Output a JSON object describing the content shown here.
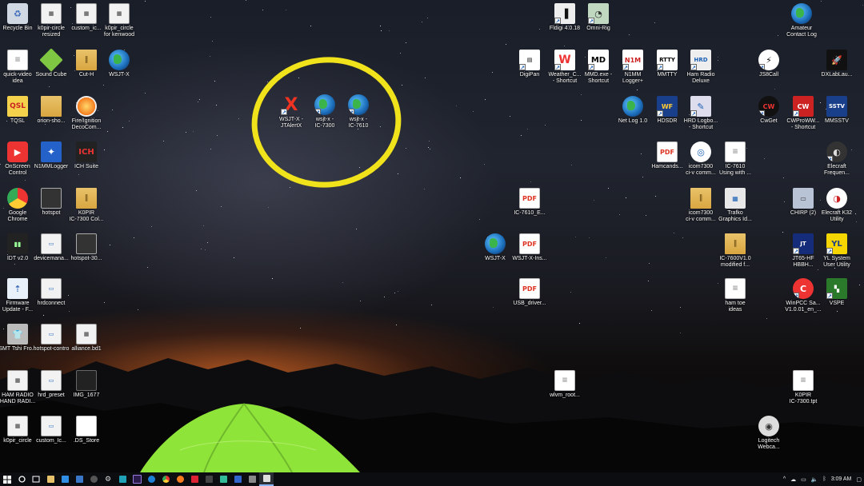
{
  "desktop": {
    "icons_left": [
      {
        "label": "Recycle Bin",
        "icon": "recycle-bin-icon"
      },
      {
        "label": "k0pir-circle\nresized",
        "icon": "image-icon"
      },
      {
        "label": "custom_ic...",
        "icon": "image-icon"
      },
      {
        "label": "k0pir_circle\nfor kenwood",
        "icon": "image-icon"
      },
      {
        "label": "quick-video\nidea",
        "icon": "document-icon"
      },
      {
        "label": "Sound Cube",
        "icon": "cube-icon"
      },
      {
        "label": "Cut-H",
        "icon": "archive-icon"
      },
      {
        "label": "WSJT-X",
        "icon": "globe-icon"
      },
      {
        "label": "TQSL",
        "icon": "tqsl-icon"
      },
      {
        "label": "orion-sho...",
        "icon": "folder-icon"
      },
      {
        "label": "Fire/Ignition\nDecoCom...",
        "icon": "fire-icon"
      },
      {
        "label": "OnScreen\nControl",
        "icon": "onscreen-control-icon"
      },
      {
        "label": "N1MMLogger",
        "icon": "satellite-icon"
      },
      {
        "label": "ICH Suite",
        "icon": "ich-icon"
      },
      {
        "label": "Google\nChrome",
        "icon": "chrome-icon"
      },
      {
        "label": "hotspot",
        "icon": "hotspot-icon"
      },
      {
        "label": "K0PIR\nIC-7300 Col...",
        "icon": "archive-icon"
      },
      {
        "label": "IDT v2.0",
        "icon": "radio-icon"
      },
      {
        "label": "devicemana...",
        "icon": "window-icon"
      },
      {
        "label": "hotspot-30...",
        "icon": "hotspot-icon"
      },
      {
        "label": "Firmware\nUpdate - F...",
        "icon": "firmware-icon"
      },
      {
        "label": "hrdconnect",
        "icon": "window-icon"
      },
      {
        "label": "SMT Tshi Fro...",
        "icon": "shirt-icon"
      },
      {
        "label": "hotspot-contro",
        "icon": "window-icon"
      },
      {
        "label": "alliance.bd1",
        "icon": "image-icon"
      },
      {
        "label": "HAM RADIO\nHAND RADI...",
        "icon": "image-icon"
      },
      {
        "label": "hrd_preset",
        "icon": "window-icon"
      },
      {
        "label": "IMG_1677",
        "icon": "phone-icon"
      },
      {
        "label": "k0pir_circle",
        "icon": "image-icon"
      },
      {
        "label": "custom_Ic...",
        "icon": "window-icon"
      },
      {
        "label": ".DS_Store",
        "icon": "file-icon"
      }
    ],
    "icons_circled": [
      {
        "label": "WSJT-X -\nJTAlertX",
        "icon": "x-icon"
      },
      {
        "label": "wsjt-x -\nIC-7300",
        "icon": "globe-icon"
      },
      {
        "label": "wsjt-x -\nIC-7610",
        "icon": "globe-icon"
      }
    ],
    "icons_middle": [
      {
        "label": "Fldigi 4.0.18",
        "icon": "fldigi-icon"
      },
      {
        "label": "Omni-Rig",
        "icon": "omnirig-icon"
      },
      {
        "label": "DigiPan",
        "icon": "digipan-icon"
      },
      {
        "label": "Weather_C...\n- Shortcut",
        "icon": "weather-icon"
      },
      {
        "label": "MMD.exe -\nShortcut",
        "icon": "md-icon"
      },
      {
        "label": "N1MM\nLogger+",
        "icon": "n1mm-icon"
      },
      {
        "label": "MMTTY",
        "icon": "rtty-icon"
      },
      {
        "label": "Ham Radio\nDeluxe",
        "icon": "hrd-icon"
      },
      {
        "label": "Net Log 1.0",
        "icon": "globe-icon"
      },
      {
        "label": "HDSDR",
        "icon": "hdsdr-icon"
      },
      {
        "label": "HRD Logbo...\n- Shortcut",
        "icon": "logbook-icon"
      },
      {
        "label": "Hamcands...",
        "icon": "pdf-icon"
      },
      {
        "label": "icom7300\nci-v comm...",
        "icon": "icom-icon"
      },
      {
        "label": "IC-7610\nUsing with ...",
        "icon": "document-icon"
      },
      {
        "label": "IC-7610_E...",
        "icon": "pdf-icon"
      },
      {
        "label": "icom7300\nci-v comm...",
        "icon": "archive-icon"
      },
      {
        "label": "Trafko\nGraphics Id...",
        "icon": "graphics-icon"
      },
      {
        "label": "WSJT-X",
        "icon": "globe-icon"
      },
      {
        "label": "WSJT-X-Ins...",
        "icon": "pdf-icon"
      },
      {
        "label": "IC-7600V1.0\nmodified f...",
        "icon": "archive-icon"
      },
      {
        "label": "USB_driver...",
        "icon": "pdf-icon"
      },
      {
        "label": "ham toe\nideas",
        "icon": "document-icon"
      },
      {
        "label": "wlvm_root...",
        "icon": "document-icon"
      }
    ],
    "icons_right": [
      {
        "label": "Amateur\nContact Log",
        "icon": "globe-icon"
      },
      {
        "label": "JS8Call",
        "icon": "js8call-icon"
      },
      {
        "label": "DXLabLau...",
        "icon": "rocket-icon"
      },
      {
        "label": "CwGet",
        "icon": "cwget-icon"
      },
      {
        "label": "CWProWW...\n- Shortcut",
        "icon": "cwpro-icon"
      },
      {
        "label": "MMSSTV",
        "icon": "mmsstv-icon"
      },
      {
        "label": "Elecraft\nFrequen...",
        "icon": "elecraft-icon"
      },
      {
        "label": "CHIRP (2)",
        "icon": "chirp-icon"
      },
      {
        "label": "Elecraft K32\nUtility",
        "icon": "elecraft-utility-icon"
      },
      {
        "label": "JT65-HF\nHBBH...",
        "icon": "jt65-icon"
      },
      {
        "label": "YL System\nUser Utility",
        "icon": "yl-icon"
      },
      {
        "label": "WinPCC Sa...\nV1.0.01_en_...",
        "icon": "winpcc-icon"
      },
      {
        "label": "VSPE",
        "icon": "vspe-icon"
      },
      {
        "label": "K0PIR\nIC-7300.tpt",
        "icon": "document-icon"
      },
      {
        "label": "Logitech\nWebca...",
        "icon": "webcam-icon"
      }
    ]
  },
  "taskbar": {
    "start_icon": "windows-start-icon",
    "time": "3:09 AM"
  },
  "colors": {
    "highlight_circle": "#f0e21b",
    "tent": "#8fe43a",
    "taskbar": "#0c0d10"
  }
}
